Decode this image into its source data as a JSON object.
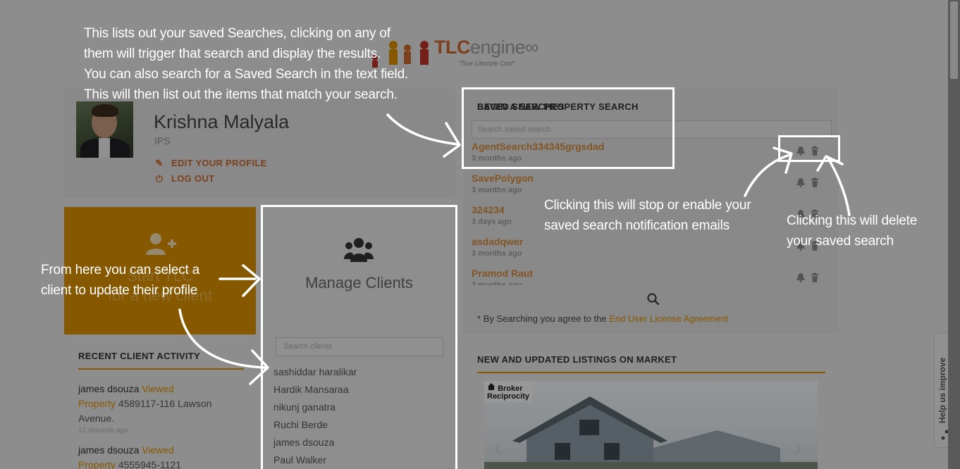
{
  "logo": {
    "brand_bold": "TLC",
    "brand_rest": "engine",
    "tagline": "\"True Lifestyle Cost\""
  },
  "profile": {
    "name": "Krishna Malyala",
    "role": "IPS",
    "edit_label": "EDIT YOUR PROFILE",
    "logout_label": "LOG OUT"
  },
  "start_tile": {
    "line1": "Start TLC",
    "line2": "for a new client"
  },
  "manage_clients": {
    "title": "Manage Clients",
    "search_placeholder": "Search clients",
    "clients": [
      "sashiddar haralikar",
      "Hardik Mansaraa",
      "nikunj ganatra",
      "Ruchi Berde",
      "james dsouza",
      "Paul Walker"
    ]
  },
  "recent_activity": {
    "title": "RECENT CLIENT ACTIVITY",
    "items": [
      {
        "who": "james dsouza",
        "verb": "Viewed",
        "obj": "Property",
        "detail": "4589117-116 Lawson Avenue.",
        "time": "12 seconds ago"
      },
      {
        "who": "james dsouza",
        "verb": "Viewed",
        "obj": "Property",
        "detail": "4555945-1121",
        "time": ""
      }
    ]
  },
  "saved_searches": {
    "title": "SAVED SEARCHES",
    "search_placeholder": "Search saved search",
    "items": [
      {
        "name": "AgentSearch334345grgsdad",
        "ago": "3 months ago"
      },
      {
        "name": "SavePolygon",
        "ago": "3 months ago"
      },
      {
        "name": "324234",
        "ago": "3 days ago"
      },
      {
        "name": "asdadqwer",
        "ago": "3 months ago"
      },
      {
        "name": "Pramod Raut",
        "ago": "3 months ago"
      }
    ],
    "begin_title": "BEGIN A NEW PROPERTY SEARCH",
    "agree_prefix": "* By Searching you agree to the ",
    "agree_link": "End User License Agreement"
  },
  "listings": {
    "title": "NEW AND UPDATED LISTINGS ON MARKET",
    "broker_line1": "Broker",
    "broker_line2": "Reciprocity"
  },
  "help_tab": {
    "label": "Help us improve"
  },
  "annotations": {
    "saved_note": [
      "This lists out your saved Searches, clicking on any of",
      "them will trigger that search and display the results.",
      "You can also search for a Saved Search in the text field.",
      "This will then list out the items that match your search."
    ],
    "notify_note": [
      "Clicking this will stop or enable your",
      "saved search notification emails"
    ],
    "delete_note": [
      "Clicking this will delete",
      "your saved search"
    ],
    "client_note": [
      "From here you can select a",
      "client to update their profile"
    ]
  },
  "colors": {
    "accent": "#d98e00",
    "brand_orange": "#c86a2e",
    "overlay": "rgba(0,0,0,0.38)"
  }
}
